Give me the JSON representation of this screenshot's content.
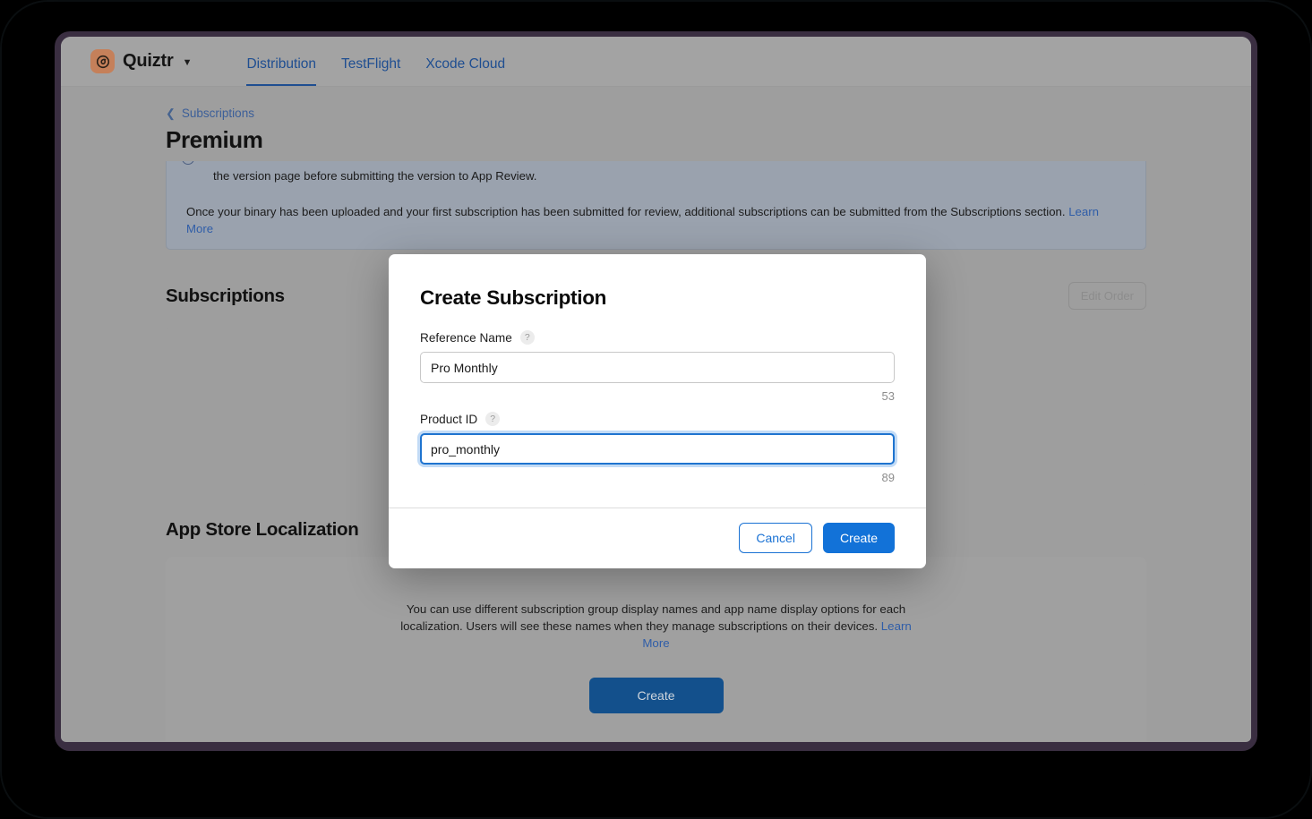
{
  "colors": {
    "accent_blue": "#1272d8",
    "link_blue": "#2f5da8",
    "nav_blue": "#1f4e91",
    "app_icon_bg": "#c5805a",
    "frame": "#3a2e41",
    "page_bg": "#9e9e9e",
    "notice_bg": "#9aa2ae",
    "loc_button_bg": "#13508c"
  },
  "header": {
    "app_name": "Quiztr",
    "app_icon": "quiztr-app-icon",
    "caret_icon": "chevron-down-icon",
    "tabs": [
      {
        "label": "Distribution",
        "active": true
      },
      {
        "label": "TestFlight",
        "active": false
      },
      {
        "label": "Xcode Cloud",
        "active": false
      }
    ]
  },
  "breadcrumb": {
    "back_icon": "chevron-left-icon",
    "label": "Subscriptions"
  },
  "page_title": "Premium",
  "notice": {
    "icon": "info-circle-icon",
    "line1": "the version page before submitting the version to App Review.",
    "para2_before": "Once your binary has been uploaded and your first subscription has been submitted for review, additional subscriptions can be submitted from the Subscriptions section. ",
    "learn_more": "Learn More"
  },
  "subscriptions_section": {
    "title": "Subscriptions",
    "edit_order_label": "Edit Order"
  },
  "localization_section": {
    "title": "App Store Localization",
    "description_before": "You can use different subscription group display names and app name display options for each localization. Users will see these names when they manage subscriptions on their devices. ",
    "learn_more": "Learn More",
    "create_label": "Create"
  },
  "dialog": {
    "title": "Create Subscription",
    "fields": [
      {
        "label": "Reference Name",
        "help_icon": "question-mark-icon",
        "value": "Pro Monthly",
        "placeholder": "",
        "counter": "53",
        "focused": false
      },
      {
        "label": "Product ID",
        "help_icon": "question-mark-icon",
        "value": "pro_monthly",
        "placeholder": "",
        "counter": "89",
        "focused": true
      }
    ],
    "cancel_label": "Cancel",
    "create_label": "Create"
  }
}
